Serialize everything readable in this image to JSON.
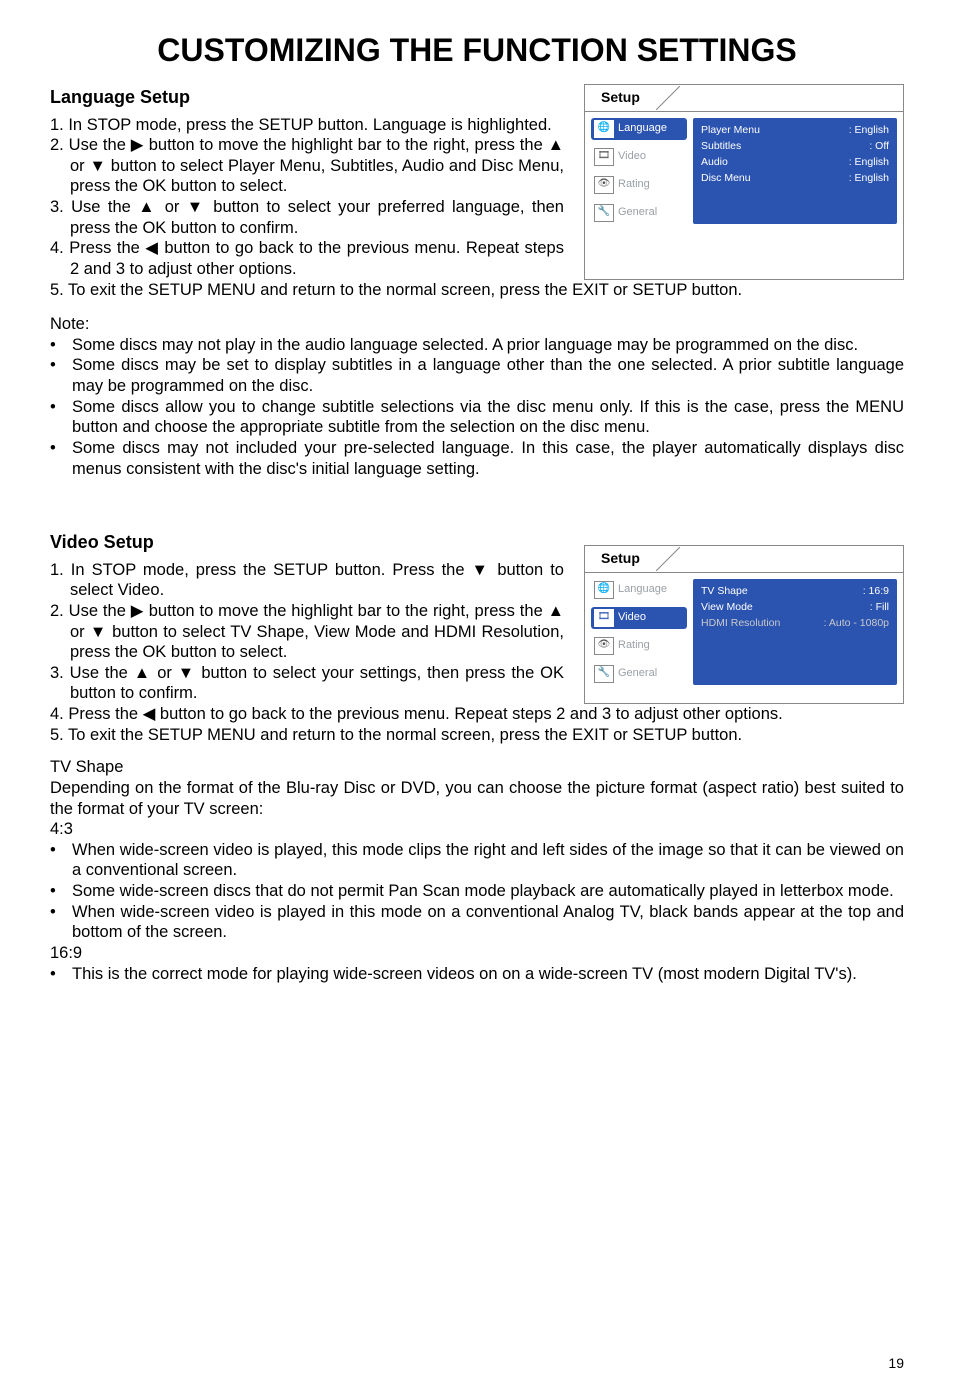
{
  "page": {
    "number": "19"
  },
  "title": "CUSTOMIZING THE FUNCTION SETTINGS",
  "lang": {
    "heading": "Language Setup",
    "steps": [
      "1. In STOP mode, press the SETUP button. Language is highlighted.",
      "2. Use the ▶ button to move the highlight bar to the right,  press the ▲ or ▼ button to select Player Menu, Subtitles, Audio and Disc Menu, press the OK button to select.",
      "3. Use the ▲ or ▼ button to select your preferred language, then press the OK button to confirm.",
      "4. Press the ◀ button to go back to the previous menu. Repeat steps 2 and 3 to adjust other options.",
      "5. To exit the SETUP MENU and return to the normal screen, press the EXIT or SETUP button."
    ],
    "noteTitle": "Note:",
    "notes": [
      "Some discs may not play in the audio language selected. A prior language may be programmed on the disc.",
      "Some discs may be set to display subtitles in a language other than the one selected. A prior subtitle language may be programmed on the disc.",
      "Some discs allow you to change subtitle selections via the disc menu only. If this is the case, press the MENU button and choose the appropriate subtitle from the selection on the disc menu.",
      "Some discs may not included your pre-selected language. In this case, the player automatically displays disc menus consistent with the disc's initial language setting."
    ]
  },
  "video": {
    "heading": "Video Setup",
    "steps": [
      "1. In STOP mode, press the SETUP button. Press the ▼ button to select Video.",
      "2. Use the ▶ button to move the highlight bar to the right,  press the ▲ or ▼ button to select TV Shape, View Mode and HDMI Resolution, press the OK button to select.",
      "3. Use the ▲ or ▼ button to select your settings, then press the OK button to confirm.",
      "4. Press the ◀ button to go back to the previous menu. Repeat steps 2 and 3 to adjust other options.",
      "5. To exit the SETUP MENU and return to the normal screen, press the EXIT or SETUP button."
    ],
    "tvshape": {
      "title": "TV Shape",
      "intro": "Depending  on the format of the Blu-ray Disc or DVD, you can choose the picture format (aspect ratio) best suited to the format of your TV screen:",
      "r43": "4:3",
      "b43": [
        "When wide-screen video is played, this mode clips the right and left sides of the image so that it can be viewed on a conventional screen.",
        "Some wide-screen discs that do not permit Pan Scan mode playback are automatically played in letterbox mode.",
        "When wide-screen video is played in this mode on a conventional Analog TV, black bands appear at the top and bottom of the screen."
      ],
      "r169": "16:9",
      "b169": [
        "This is the correct mode for playing wide-screen videos on on a wide-screen TV (most modern Digital TV's)."
      ]
    }
  },
  "panel": {
    "title": "Setup",
    "tabs": {
      "language": "Language",
      "video": "Video",
      "rating": "Rating",
      "general": "General"
    },
    "langRows": [
      {
        "k": "Player Menu",
        "v": ":  English"
      },
      {
        "k": "Subtitles",
        "v": ":  Off"
      },
      {
        "k": "Audio",
        "v": ":  English"
      },
      {
        "k": "Disc Menu",
        "v": ":  English"
      }
    ],
    "videoRows": [
      {
        "k": "TV Shape",
        "v": ":  16:9",
        "dim": false
      },
      {
        "k": "View Mode",
        "v": ":  Fill",
        "dim": false
      },
      {
        "k": "HDMI Resolution",
        "v": ":  Auto - 1080p",
        "dim": true
      }
    ]
  }
}
